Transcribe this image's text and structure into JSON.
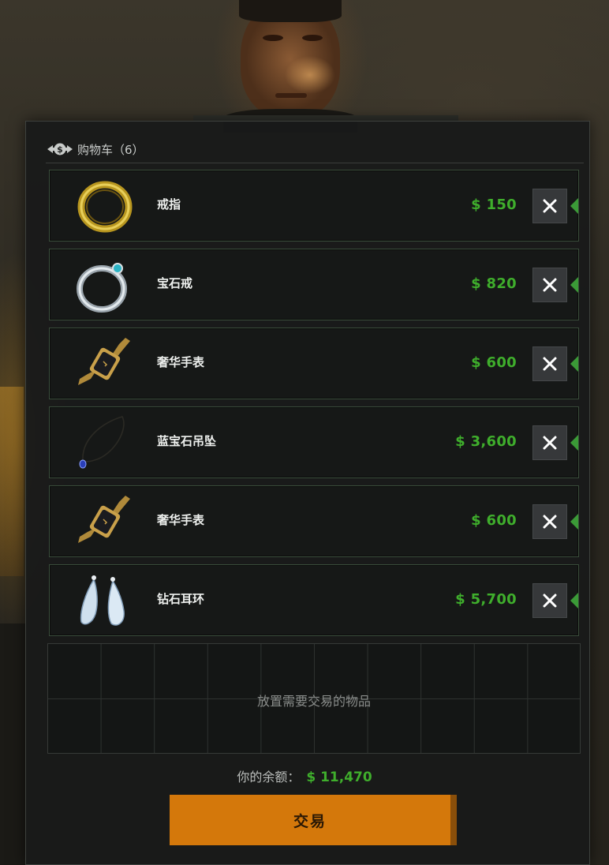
{
  "cart": {
    "title": "购物车（6）",
    "items": [
      {
        "name": "戒指",
        "price": "$ 150",
        "icon": "gold-ring"
      },
      {
        "name": "宝石戒",
        "price": "$ 820",
        "icon": "gem-ring"
      },
      {
        "name": "奢华手表",
        "price": "$ 600",
        "icon": "luxury-watch"
      },
      {
        "name": "蓝宝石吊坠",
        "price": "$ 3,600",
        "icon": "sapphire-pendant"
      },
      {
        "name": "奢华手表",
        "price": "$ 600",
        "icon": "luxury-watch"
      },
      {
        "name": "钻石耳环",
        "price": "$ 5,700",
        "icon": "diamond-earrings"
      }
    ]
  },
  "dropzone": {
    "text": "放置需要交易的物品"
  },
  "balance": {
    "label": "你的余额：",
    "value": "$ 11,470"
  },
  "trade_button": {
    "label": "交易"
  },
  "colors": {
    "price_green": "#3fae2c",
    "trade_orange": "#d4780b",
    "panel_bg": "#181a19"
  }
}
